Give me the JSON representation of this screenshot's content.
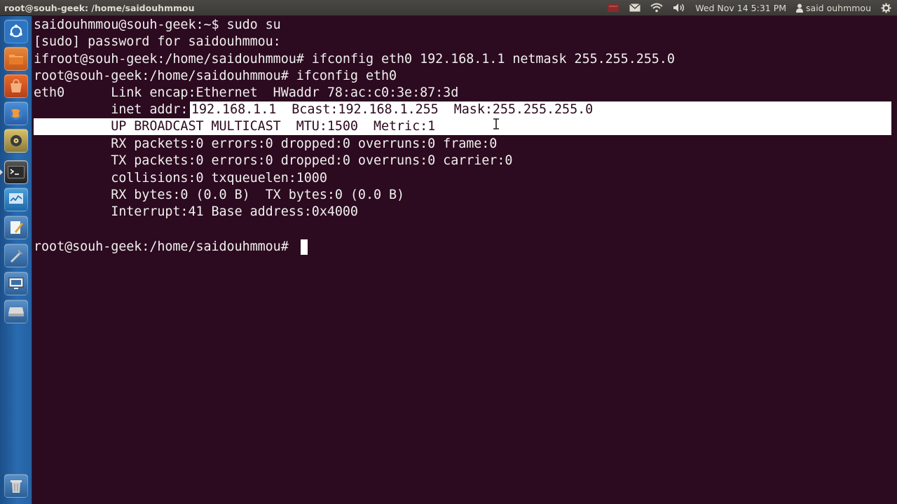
{
  "panel": {
    "window_title": "root@souh-geek: /home/saidouhmmou",
    "datetime": "Wed Nov 14  5:31 PM",
    "user": "said ouhmmou",
    "icons": [
      "keyboard-layout-icon",
      "mail-icon",
      "wifi-icon",
      "volume-icon",
      "user-icon",
      "gear-icon"
    ]
  },
  "launcher": {
    "items": [
      "ubuntu-dash-icon",
      "files-icon",
      "software-center-icon",
      "browser-icon",
      "audio-player-icon",
      "terminal-icon",
      "system-monitor-icon",
      "text-editor-icon",
      "tools-icon",
      "remote-desktop-icon",
      "drive-icon",
      "trash-icon"
    ],
    "active": "terminal-icon",
    "colors": {
      "bg": "#2462a3"
    }
  },
  "terminal": {
    "colors": {
      "bg": "#2c0a1f",
      "fg": "#f0f0f0",
      "selection": "#ffffff"
    },
    "lines": [
      "saidouhmmou@souh-geek:~$ sudo su",
      "[sudo] password for saidouhmmou:",
      "ifroot@souh-geek:/home/saidouhmmou# ifconfig eth0 192.168.1.1 netmask 255.255.255.0",
      "root@souh-geek:/home/saidouhmmou# ifconfig eth0",
      "eth0      Link encap:Ethernet  HWaddr 78:ac:c0:3e:87:3d",
      "          inet addr:",
      "192.168.1.1  Bcast:192.168.1.255  Mask:255.255.255.0",
      "          UP BROADCAST MULTICAST  MTU:1500  Metric:1",
      "          RX packets:0 errors:0 dropped:0 overruns:0 frame:0",
      "          TX packets:0 errors:0 dropped:0 overruns:0 carrier:0",
      "          collisions:0 txqueuelen:1000",
      "          RX bytes:0 (0.0 B)  TX bytes:0 (0.0 B)",
      "          Interrupt:41 Base address:0x4000",
      "root@souh-geek:/home/saidouhmmou# "
    ]
  }
}
